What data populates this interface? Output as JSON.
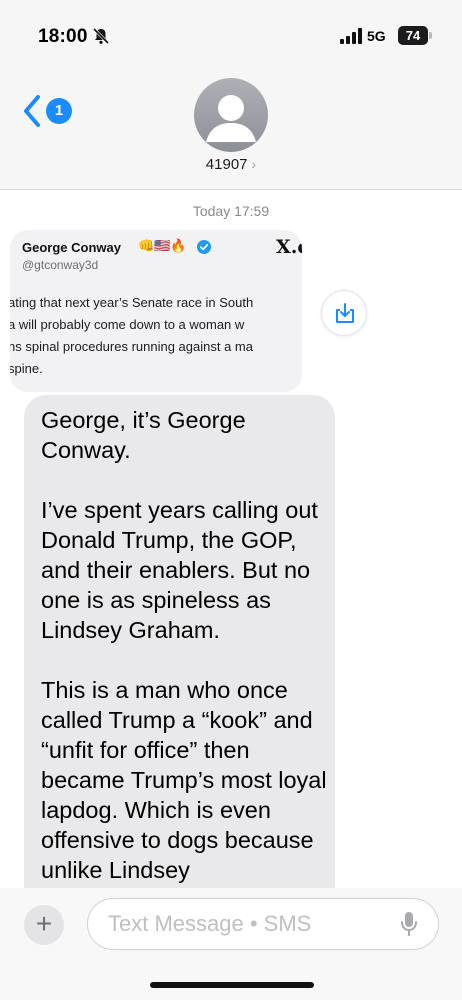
{
  "status_bar": {
    "time": "18:00",
    "network": "5G",
    "battery": "74",
    "icons": [
      "bell-slash-icon",
      "signal-icon",
      "battery-icon"
    ]
  },
  "header": {
    "back_badge": "1",
    "contact": "41907",
    "contact_chevron": "›"
  },
  "conversation": {
    "timestamp": "Today 17:59",
    "tweet_card": {
      "author": "George Conway",
      "emojis": "👊🇺🇸🔥",
      "handle": "@gtconway3d",
      "logo": "X.c",
      "lines": [
        "ating that next year’s Senate race in South",
        " a will probably come down to a woman w",
        "ns spinal procedures running against a ma",
        " spine."
      ]
    },
    "message": "George, it’s George Conway.\n\nI’ve spent years calling out Donald Trump, the GOP, and their enablers. But no one is as spineless as Lindsey Graham.\n\nThis is a man who once called Trump a “kook” and “unfit for office” then became Trump’s most loyal lapdog. Which is even offensive to dogs because unlike Lindsey"
  },
  "input": {
    "plus": "+",
    "placeholder": "Text Message • SMS"
  },
  "colors": {
    "accent": "#1a8cff",
    "bubble": "#e9e9eb",
    "header_bg": "#f6f6f7"
  }
}
